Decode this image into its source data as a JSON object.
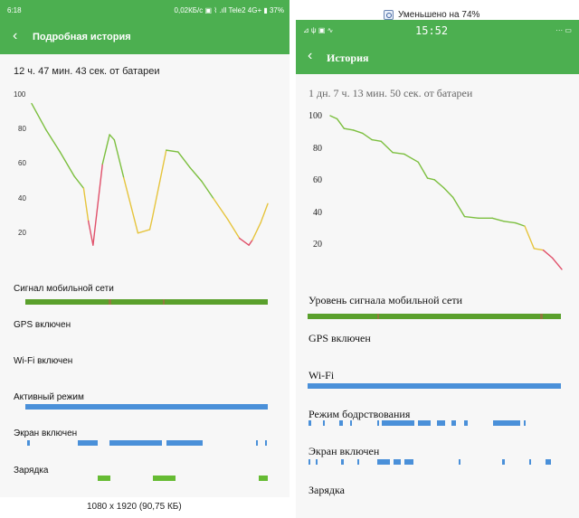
{
  "left_phone": {
    "status_bar": {
      "time": "6:18",
      "right_text": "0,02КБ/с ▣ ⌇ .ıll Tele2 4G+ ▮ 37%"
    },
    "toolbar": {
      "back": "‹",
      "title": "Подробная история"
    },
    "duration": "12 ч. 47 мин. 43 сек. от батареи",
    "chart_data": {
      "type": "line",
      "title": "",
      "xlabel": "",
      "ylabel": "",
      "ylim": [
        0,
        100
      ],
      "yticks": [
        "20",
        "40",
        "60",
        "80",
        "100"
      ],
      "series": [
        {
          "x": [
            0,
            6,
            12,
            18,
            22,
            24,
            26,
            30,
            33,
            35,
            39,
            45,
            50,
            51,
            57,
            62,
            67,
            72,
            77,
            83,
            88,
            92,
            93.5,
            97,
            100
          ],
          "y": [
            95,
            80,
            67,
            53,
            46,
            27,
            13,
            60,
            77,
            74,
            52,
            20,
            22,
            28,
            68,
            67,
            58,
            50,
            40,
            28,
            17,
            13,
            16,
            26,
            37
          ]
        }
      ],
      "color_scale": {
        "high": "#7cbf3f",
        "mid": "#e6c43c",
        "low": "#e0506a"
      }
    },
    "rows": [
      {
        "label": "Сигнал мобильной сети",
        "bar": "signal"
      },
      {
        "label": "GPS включен",
        "bar": "none"
      },
      {
        "label": "Wi-Fi включен",
        "bar": "none"
      },
      {
        "label": "Активный режим",
        "bar": "full"
      },
      {
        "label": "Экран включен",
        "bar": "segments"
      },
      {
        "label": "Зарядка",
        "bar": "charging"
      }
    ],
    "colors": {
      "accent": "#4caf50",
      "signal_bar": "#5aa02c",
      "active_bar": "#4a90d9",
      "charging": "#66bb33"
    }
  },
  "right_phone": {
    "status_bar": {
      "left": "⊿ ψ ▣ ∿",
      "time": "15:52",
      "right": "··· ▭"
    },
    "toolbar": {
      "back": "‹",
      "title": "История"
    },
    "duration": "1 дн. 7 ч. 13 мин. 50 сек. от батареи",
    "chart_data": {
      "type": "line",
      "title": "",
      "xlabel": "",
      "ylabel": "",
      "ylim": [
        0,
        100
      ],
      "yticks": [
        "20",
        "40",
        "60",
        "80",
        "100"
      ],
      "series": [
        {
          "x": [
            0,
            3,
            6,
            10,
            14,
            18,
            22,
            27,
            32,
            38,
            42,
            45,
            49,
            53,
            58,
            64,
            70,
            75,
            80,
            84,
            88,
            92,
            96,
            100
          ],
          "y": [
            100,
            98,
            92,
            91,
            89,
            85,
            84,
            77,
            76,
            71,
            61,
            60,
            55,
            49,
            37,
            36,
            36,
            34,
            33,
            31,
            17,
            16,
            11,
            4
          ]
        }
      ],
      "color_scale": {
        "high": "#7cbf3f",
        "mid": "#e6c43c",
        "low": "#e0506a"
      }
    },
    "rows": [
      {
        "label": "Уровень сигнала мобильной сети",
        "bar": "signal"
      },
      {
        "label": "GPS включен",
        "bar": "none"
      },
      {
        "label": "Wi-Fi",
        "bar": "full"
      },
      {
        "label": "Режим бодрствования",
        "bar": "segments"
      },
      {
        "label": "Экран включен",
        "bar": "segments"
      },
      {
        "label": "Зарядка",
        "bar": "none"
      }
    ],
    "colors": {
      "accent": "#4caf50",
      "signal_bar": "#5aa02c",
      "active_bar": "#4a90d9"
    }
  },
  "caption_bottom": "1080 x 1920 (90,75 КБ)",
  "caption_top": "Уменьшено на 74%"
}
